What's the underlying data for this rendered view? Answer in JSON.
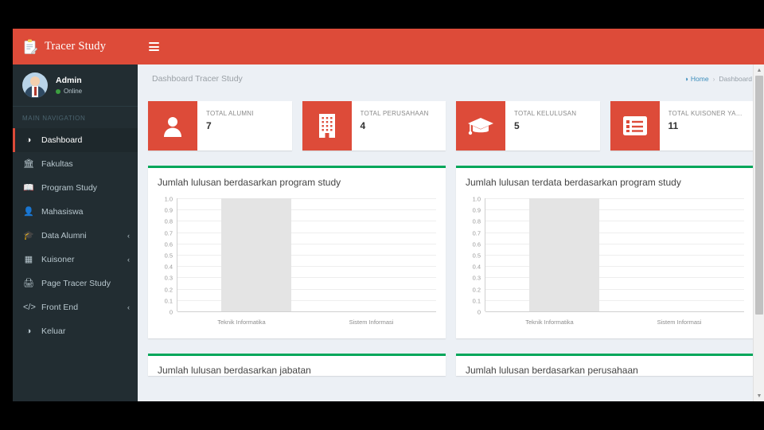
{
  "app": {
    "brand": "Tracer Study",
    "brand_icon": "clipboard-icon",
    "menu_toggle_icon": "hamburger-icon"
  },
  "sidebar": {
    "user": {
      "name": "Admin",
      "status": "Online",
      "avatar_icon": "user-avatar-icon"
    },
    "nav_header": "MAIN NAVIGATION",
    "items": [
      {
        "label": "Dashboard",
        "icon": "dashboard-icon",
        "active": true,
        "arrow": ""
      },
      {
        "label": "Fakultas",
        "icon": "bank-icon",
        "active": false,
        "arrow": ""
      },
      {
        "label": "Program Study",
        "icon": "book-icon",
        "active": false,
        "arrow": ""
      },
      {
        "label": "Mahasiswa",
        "icon": "user-icon",
        "active": false,
        "arrow": ""
      },
      {
        "label": "Data Alumni",
        "icon": "graduation-cap-icon",
        "active": false,
        "arrow": "‹"
      },
      {
        "label": "Kuisoner",
        "icon": "list-alt-icon",
        "active": false,
        "arrow": "‹"
      },
      {
        "label": "Page Tracer Study",
        "icon": "print-icon",
        "active": false,
        "arrow": ""
      },
      {
        "label": "Front End",
        "icon": "code-icon",
        "active": false,
        "arrow": "‹"
      },
      {
        "label": "Keluar",
        "icon": "dashboard-icon",
        "active": false,
        "arrow": ""
      }
    ]
  },
  "content_header": {
    "page_title": "Dashboard Tracer Study",
    "breadcrumb": {
      "home_label": "Home",
      "home_icon": "dashboard-icon",
      "separator": "›",
      "current_label": "Dashboard"
    }
  },
  "info_boxes": [
    {
      "text": "TOTAL ALUMNI",
      "number": "7",
      "icon": "user-icon",
      "color": "#dd4b39"
    },
    {
      "text": "TOTAL PERUSAHAAN",
      "number": "4",
      "icon": "building-icon",
      "color": "#dd4b39"
    },
    {
      "text": "TOTAL KELULUSAN",
      "number": "5",
      "icon": "graduation-cap-icon",
      "color": "#dd4b39"
    },
    {
      "text": "TOTAL KUISONER YA…",
      "number": "11",
      "icon": "list-alt-icon",
      "color": "#dd4b39"
    }
  ],
  "panels": [
    {
      "title": "Jumlah lulusan berdasarkan program study"
    },
    {
      "title": "Jumlah lulusan terdata berdasarkan program study"
    }
  ],
  "panels_cut": [
    {
      "title": "Jumlah lulusan berdasarkan jabatan"
    },
    {
      "title": "Jumlah lulusan berdasarkan perusahaan"
    }
  ],
  "theme": {
    "brand_red": "#dd4b39",
    "sidebar_dark": "#222d32",
    "panel_accent_green": "#00a65a",
    "content_bg": "#ecf0f5",
    "bar_fill": "#e4e4e4"
  },
  "chart_data": [
    {
      "type": "bar",
      "title": "Jumlah lulusan berdasarkan program study",
      "categories": [
        "Teknik Informatika",
        "Sistem Informasi"
      ],
      "values": [
        1.0,
        0
      ],
      "yticks": [
        "1.0",
        "0.9",
        "0.8",
        "0.7",
        "0.6",
        "0.5",
        "0.4",
        "0.3",
        "0.2",
        "0.1",
        "0"
      ],
      "ylim": [
        0,
        1.0
      ],
      "xlabel": "",
      "ylabel": "",
      "grid": true,
      "legend": "none"
    },
    {
      "type": "bar",
      "title": "Jumlah lulusan terdata berdasarkan program study",
      "categories": [
        "Teknik Informatika",
        "Sistem Informasi"
      ],
      "values": [
        1.0,
        0
      ],
      "yticks": [
        "1.0",
        "0.9",
        "0.8",
        "0.7",
        "0.6",
        "0.5",
        "0.4",
        "0.3",
        "0.2",
        "0.1",
        "0"
      ],
      "ylim": [
        0,
        1.0
      ],
      "xlabel": "",
      "ylabel": "",
      "grid": true,
      "legend": "none"
    }
  ]
}
